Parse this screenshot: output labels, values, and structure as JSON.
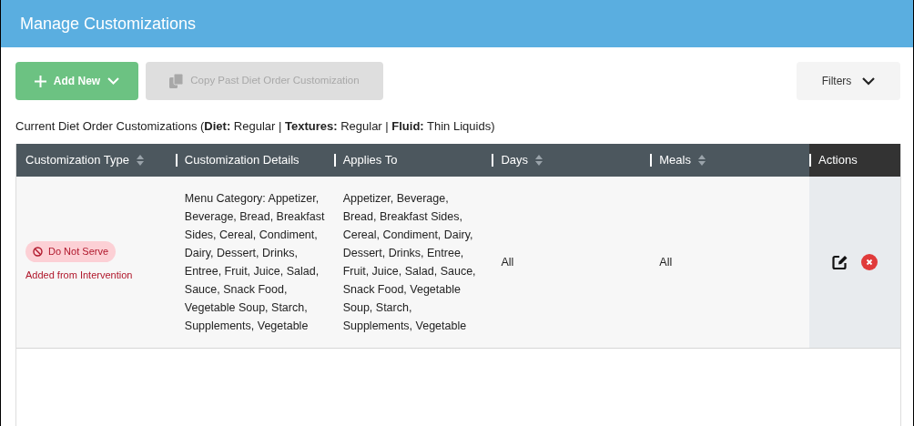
{
  "header": {
    "title": "Manage Customizations"
  },
  "toolbar": {
    "add_button": {
      "label": "Add New",
      "disabled": false
    },
    "copy_button": {
      "label": "Copy Past Diet Order Customization",
      "disabled": true
    },
    "filters_button": {
      "label": "Filters"
    }
  },
  "summary": "Current Diet Order Customizations (**Diet:** Regular | **Textures:** Regular | **Fluid:** Thin Liquids)",
  "table": {
    "columns": [
      {
        "label": "Customization Type",
        "sortable": true
      },
      {
        "label": "Customization Details",
        "sortable": false
      },
      {
        "label": "Applies To",
        "sortable": false
      },
      {
        "label": "Days",
        "sortable": true
      },
      {
        "label": "Meals",
        "sortable": true
      },
      {
        "label": "Actions",
        "sortable": false
      }
    ],
    "rows": [
      {
        "badge": "Do Not Serve",
        "source": "Added from Intervention",
        "details": "Menu Category: Appetizer, Beverage, Bread, Breakfast Sides, Cereal, Condiment, Dairy, Dessert, Drinks, Entree, Fruit, Juice, Salad, Sauce, Snack Food, Vegetable Soup, Starch, Supplements, Vegetable",
        "applies_to": "Appetizer, Beverage, Bread, Breakfast Sides, Cereal, Condiment, Dairy, Dessert, Drinks, Entree, Fruit, Juice, Salad, Sauce, Snack Food, Vegetable Soup, Starch, Supplements, Vegetable",
        "days": "All",
        "meals": "All"
      }
    ]
  }
}
